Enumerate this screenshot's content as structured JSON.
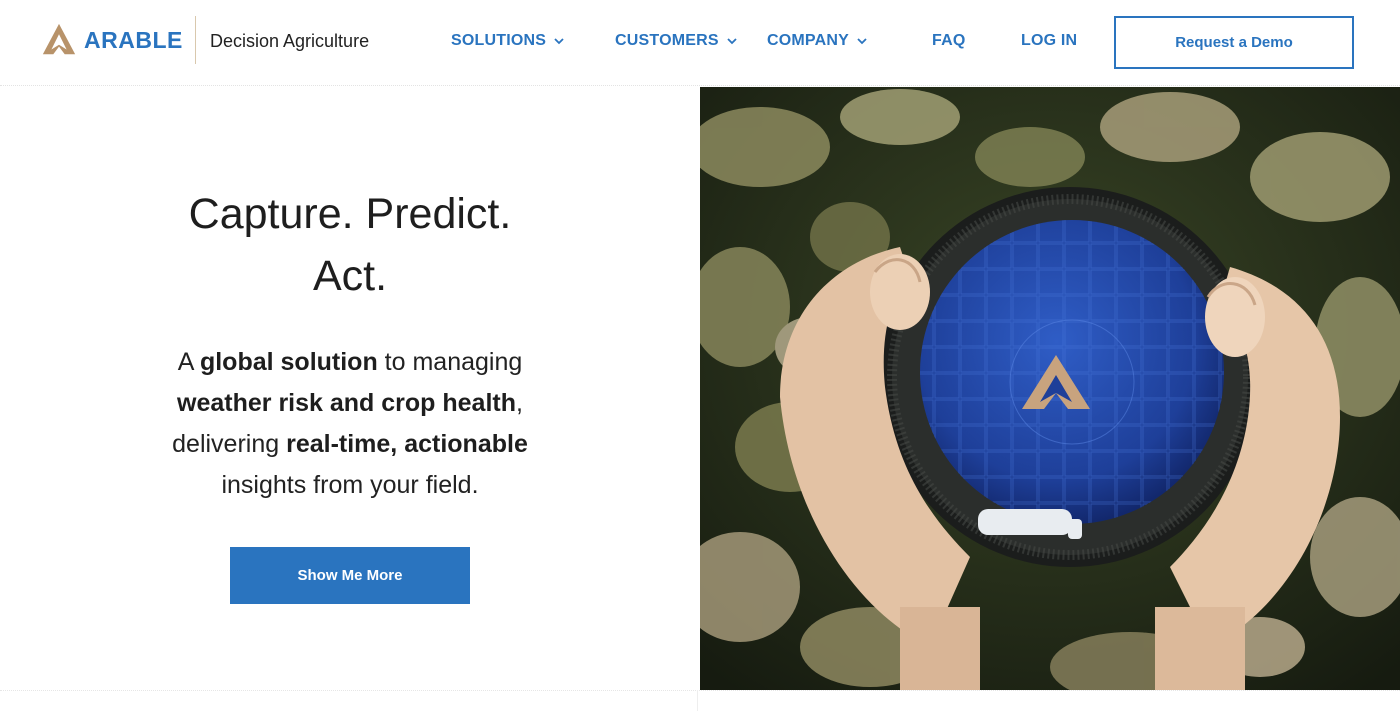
{
  "brand": {
    "name": "ARABLE",
    "tagline": "Decision Agriculture",
    "colors": {
      "accent": "#2a74bf",
      "logo": "#b8936a"
    }
  },
  "nav": {
    "solutions": "SOLUTIONS",
    "customers": "CUSTOMERS",
    "company": "COMPANY",
    "faq": "FAQ",
    "login": "LOG IN",
    "demo": "Request a Demo"
  },
  "hero": {
    "headline_line1": "Capture. Predict.",
    "headline_line2": "Act.",
    "sub": {
      "p1": "A ",
      "b1": "global solution",
      "p2": " to managing ",
      "b2": "weather risk and crop health",
      "p3": ", delivering ",
      "b3": "real-time, actionable",
      "p4": " insights from your field."
    },
    "cta": "Show Me More"
  },
  "image": {
    "subject": "hands holding Arable Mark device over crop canopy"
  }
}
